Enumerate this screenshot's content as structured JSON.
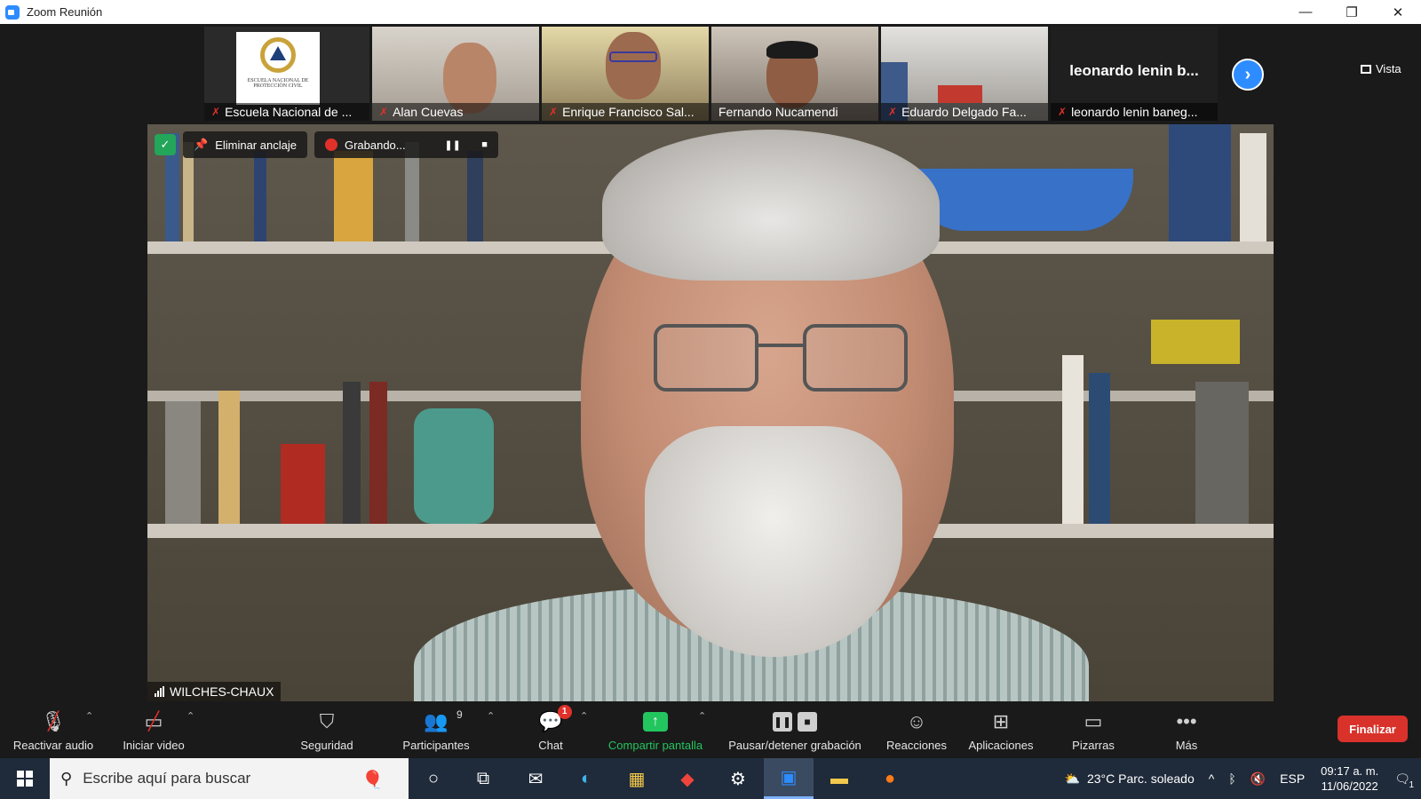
{
  "window": {
    "title": "Zoom Reunión",
    "controls": [
      "—",
      "❐",
      "✕"
    ]
  },
  "thumbnails": [
    {
      "name": "Escuela Nacional de ...",
      "muted": true
    },
    {
      "name": "Alan Cuevas",
      "muted": true
    },
    {
      "name": "Enrique Francisco Sal...",
      "muted": true
    },
    {
      "name": "Fernando Nucamendi",
      "muted": false
    },
    {
      "name": "Eduardo Delgado Fa...",
      "muted": true
    },
    {
      "name": "leonardo lenin baneg...",
      "muted": true,
      "big_name": "leonardo lenin b..."
    }
  ],
  "logo": {
    "text": "ESCUELA NACIONAL DE PROTECCIÓN CIVIL"
  },
  "view_button": {
    "label": "Vista"
  },
  "meeting_bar": {
    "unpin_label": "Eliminar anclaje",
    "recording_label": "Grabando..."
  },
  "speaker": {
    "name": "WILCHES-CHAUX"
  },
  "toolbar": {
    "unmute": "Reactivar audio",
    "start_video": "Iniciar video",
    "security": "Seguridad",
    "participants": "Participantes",
    "participants_count": "9",
    "chat": "Chat",
    "chat_badge": "1",
    "share": "Compartir pantalla",
    "recording": "Pausar/detener grabación",
    "reactions": "Reacciones",
    "apps": "Aplicaciones",
    "whiteboards": "Pizarras",
    "more": "Más",
    "end": "Finalizar"
  },
  "taskbar": {
    "search_placeholder": "Escribe aquí para buscar",
    "weather": "23°C  Parc. soleado",
    "language": "ESP",
    "time": "09:17 a. m.",
    "date": "11/06/2022",
    "notifications": "1"
  },
  "colors": {
    "accent": "#2d8cff",
    "danger": "#e0312b",
    "success": "#23c55e",
    "end_button": "#d9322b"
  }
}
